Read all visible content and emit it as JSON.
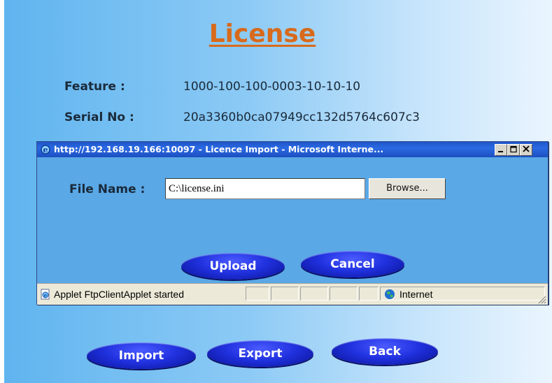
{
  "page": {
    "title": "License",
    "feature_label": "Feature :",
    "feature_value": "1000-100-100-0003-10-10-10",
    "serial_label": "Serial No :",
    "serial_value": "20a3360b0ca07949cc132d5764c607c3"
  },
  "popup": {
    "title": "http://192.168.19.166:10097 - Licence Import - Microsoft Interne...",
    "file_name_label": "File Name :",
    "file_name_value": "C:\\license.ini",
    "browse_label": "Browse...",
    "upload_label": "Upload",
    "cancel_label": "Cancel",
    "status_text": "Applet FtpClientApplet started",
    "zone_text": "Internet",
    "window_buttons": [
      "minimize",
      "maximize",
      "close"
    ]
  },
  "actions": {
    "import_label": "Import",
    "export_label": "Export",
    "back_label": "Back"
  },
  "colors": {
    "title": "#d86a1c",
    "button": "#2132e0",
    "titlebar": "#1f55c8",
    "popup_bg": "#5aa8e6"
  }
}
